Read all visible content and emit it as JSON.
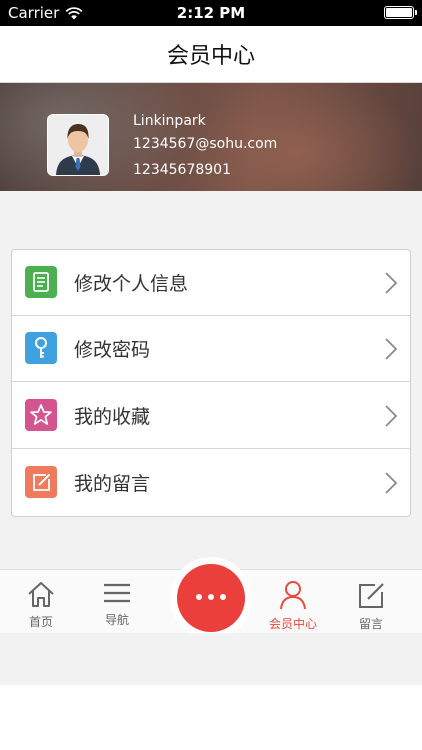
{
  "status_bar": {
    "carrier": "Carrier",
    "time": "2:12 PM",
    "battery_level": 1.0
  },
  "nav": {
    "title": "会员中心"
  },
  "profile": {
    "username": "Linkinpark",
    "email": "1234567@sohu.com",
    "phone": "12345678901",
    "avatar_icon": "businessman-avatar-icon"
  },
  "menu": {
    "items": [
      {
        "label": "修改个人信息",
        "icon": "document-icon",
        "color": "#4caf50"
      },
      {
        "label": "修改密码",
        "icon": "key-icon",
        "color": "#3fa1e0"
      },
      {
        "label": "我的收藏",
        "icon": "star-icon",
        "color": "#d4548f"
      },
      {
        "label": "我的留言",
        "icon": "edit-icon",
        "color": "#f07a5e"
      }
    ]
  },
  "tabs": {
    "items": [
      {
        "label": "首页",
        "icon": "home-icon"
      },
      {
        "label": "导航",
        "icon": "menu-icon"
      },
      {
        "label": "",
        "icon": "more-dots-icon"
      },
      {
        "label": "会员中心",
        "icon": "user-icon",
        "active": true
      },
      {
        "label": "留言",
        "icon": "edit-icon"
      }
    ]
  },
  "colors": {
    "accent": "#e84a3f",
    "center_button": "#ea3f3a"
  }
}
